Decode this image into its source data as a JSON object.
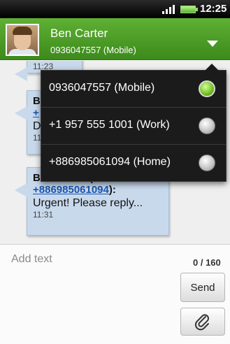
{
  "status_bar": {
    "time": "12:25",
    "signal_icon": "signal-bars-icon",
    "battery_icon": "battery-icon"
  },
  "header": {
    "contact_name": "Ben Carter",
    "contact_number": "0936047557 (Mobile)",
    "avatar_icon": "contact-avatar",
    "dropdown_icon": "chevron-down-icon"
  },
  "conversation": {
    "messages": [
      {
        "time": "11:23"
      },
      {
        "sender_fragment": "B",
        "link_fragment": "+",
        "text_fragment": "D",
        "time_fragment": "11"
      },
      {
        "sender": "Ben Carter (+",
        "number": "+886985061094",
        "suffix": "):",
        "text": "Urgent! Please reply...",
        "time": "11:31"
      }
    ]
  },
  "phone_menu": {
    "options": [
      {
        "label": "0936047557 (Mobile)",
        "selected": true
      },
      {
        "label": "+1 957 555 1001 (Work)",
        "selected": false
      },
      {
        "label": "+886985061094 (Home)",
        "selected": false
      }
    ]
  },
  "composer": {
    "placeholder": "Add text",
    "char_counter": "0 / 160",
    "send_label": "Send",
    "attach_icon": "paperclip-icon"
  },
  "colors": {
    "header_green": "#4c9e28",
    "bubble_blue": "#c9d9ec",
    "radio_green": "#7ac32a"
  }
}
